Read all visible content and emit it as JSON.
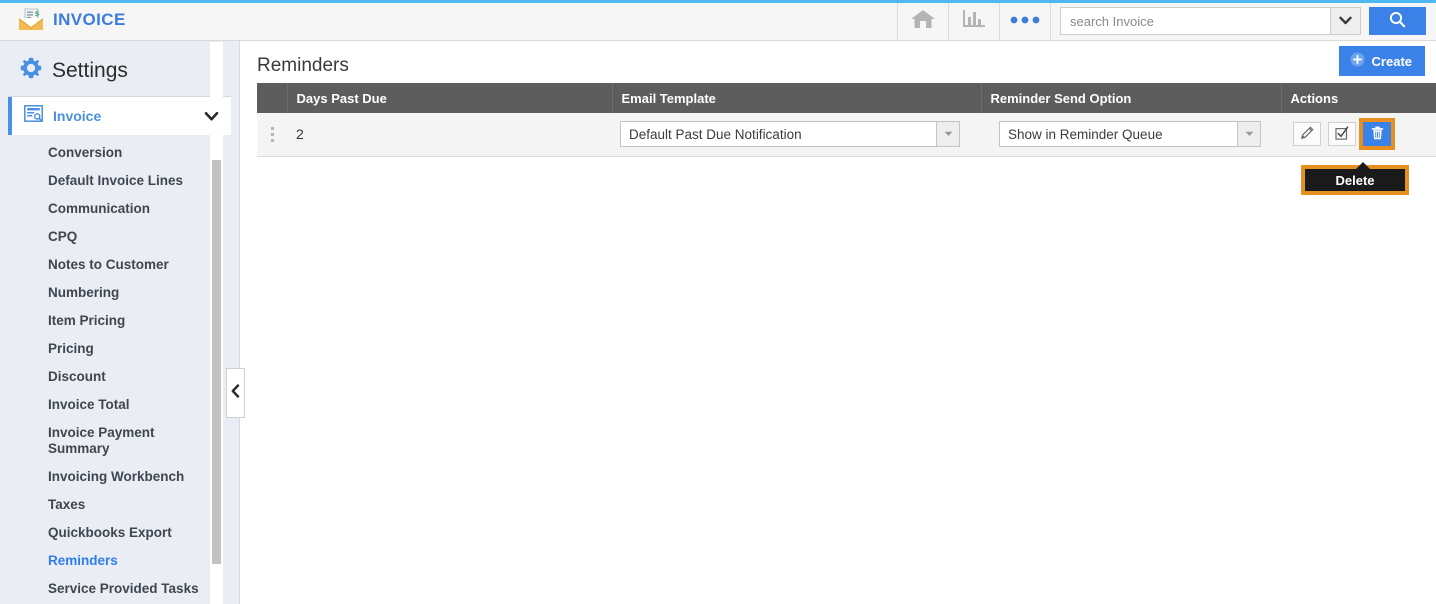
{
  "topbar": {
    "brand_title": "INVOICE",
    "brand_logo_icon": "invoice-envelope-icon",
    "home_icon": "home-icon",
    "reports_icon": "bar-chart-icon",
    "more_icon": "ellipsis-icon",
    "search_placeholder": "search Invoice",
    "search_value": "",
    "search_caret_icon": "chevron-down-icon",
    "search_button_icon": "magnifier-icon",
    "accent_color": "#4eb8f0"
  },
  "sidebar": {
    "settings_label": "Settings",
    "settings_icon": "gear-icon",
    "parent": {
      "label": "Invoice",
      "icon": "invoice-doc-icon",
      "caret_icon": "chevron-down-icon"
    },
    "items": [
      {
        "label": "Conversion",
        "active": false
      },
      {
        "label": "Default Invoice Lines",
        "active": false
      },
      {
        "label": "Communication",
        "active": false
      },
      {
        "label": "CPQ",
        "active": false
      },
      {
        "label": "Notes to Customer",
        "active": false
      },
      {
        "label": "Numbering",
        "active": false
      },
      {
        "label": "Item Pricing",
        "active": false
      },
      {
        "label": "Pricing",
        "active": false
      },
      {
        "label": "Discount",
        "active": false
      },
      {
        "label": "Invoice Total",
        "active": false
      },
      {
        "label": "Invoice Payment Summary",
        "active": false
      },
      {
        "label": "Invoicing Workbench",
        "active": false
      },
      {
        "label": "Taxes",
        "active": false
      },
      {
        "label": "Quickbooks Export",
        "active": false
      },
      {
        "label": "Reminders",
        "active": true
      },
      {
        "label": "Service Provided Tasks",
        "active": false
      }
    ],
    "collapse_icon": "chevron-left-icon",
    "active_color": "#2f7ded"
  },
  "main": {
    "page_title": "Reminders",
    "create_label": "Create",
    "create_icon": "plus-circle-icon",
    "create_color": "#3b82e8",
    "table": {
      "header_color": "#5d5d5d",
      "columns": [
        "",
        "Days Past Due",
        "Email Template",
        "Reminder Send Option",
        "Actions"
      ],
      "rows": [
        {
          "grip_icon": "drag-handle-icon",
          "days_past_due": "2",
          "email_template": "Default Past Due Notification",
          "email_template_arrow_icon": "chevron-down-icon",
          "reminder_send_option": "Show in Reminder Queue",
          "reminder_send_option_arrow_icon": "chevron-down-icon",
          "actions": [
            {
              "name": "edit",
              "icon": "pencil-icon",
              "state": "default"
            },
            {
              "name": "select",
              "icon": "checkbox-icon",
              "state": "default"
            },
            {
              "name": "delete",
              "icon": "trash-icon",
              "state": "active-highlighted"
            }
          ]
        }
      ]
    }
  },
  "tooltip": {
    "text": "Delete",
    "background": "#1a1a1a",
    "highlight_color": "#e8901f"
  }
}
